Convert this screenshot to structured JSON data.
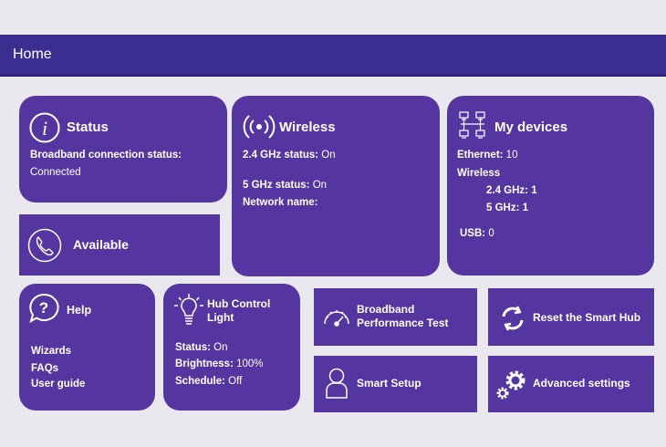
{
  "header": {
    "title": "Home"
  },
  "status": {
    "title": "Status",
    "connection_label": "Broadband connection status:",
    "connection_value": "Connected"
  },
  "phone": {
    "label": "Available"
  },
  "wireless": {
    "title": "Wireless",
    "ghz24_label": "2.4 GHz status:",
    "ghz24_value": " On",
    "ghz5_label": "5 GHz status:",
    "ghz5_value": " On",
    "network_label": "Network name:"
  },
  "devices": {
    "title": "My devices",
    "ethernet_label": "Ethernet:",
    "ethernet_value": " 10",
    "wireless_label": "Wireless",
    "ghz24_label": "2.4 GHz: 1",
    "ghz5_label": "5 GHz: 1",
    "usb_label": "USB:",
    "usb_value": " 0"
  },
  "help": {
    "title": "Help",
    "links": [
      "Wizards",
      "FAQs",
      "User guide"
    ]
  },
  "hub_light": {
    "title_line1": "Hub Control",
    "title_line2": "Light",
    "status_label": "Status:",
    "status_value": " On",
    "brightness_label": "Brightness:",
    "brightness_value": " 100%",
    "schedule_label": "Schedule:",
    "schedule_value": " Off"
  },
  "actions": {
    "performance_line1": "Broadband",
    "performance_line2": "Performance Test",
    "reset": "Reset the Smart Hub",
    "smart_setup": "Smart Setup",
    "advanced": "Advanced settings"
  },
  "colors": {
    "background": "#e9e8ee",
    "header": "#3a2f91",
    "tile": "#5535a0",
    "text": "#ffffff"
  }
}
